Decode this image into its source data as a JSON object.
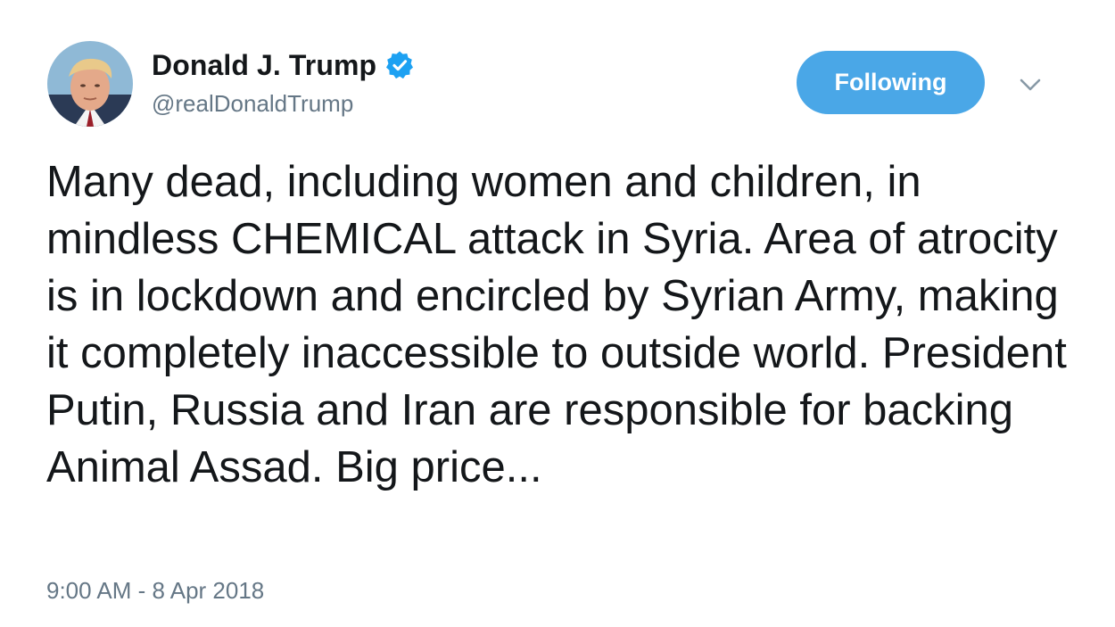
{
  "author": {
    "display_name": "Donald J. Trump",
    "handle": "@realDonaldTrump",
    "verified": true,
    "avatar_icon": "profile-photo"
  },
  "follow_button": {
    "label": "Following"
  },
  "menu": {
    "icon": "chevron-down-icon"
  },
  "tweet": {
    "text": "Many dead, including women and children, in mindless CHEMICAL attack in Syria. Area of atrocity is in lockdown and encircled by Syrian Army, making it completely inaccessible to outside world. President Putin, Russia and Iran are responsible for backing Animal Assad. Big price...",
    "timestamp": "9:00 AM - 8 Apr 2018"
  },
  "colors": {
    "accent": "#1da1f2",
    "button_bg": "#4aa7e7",
    "text": "#14171a",
    "secondary_text": "#657786"
  }
}
